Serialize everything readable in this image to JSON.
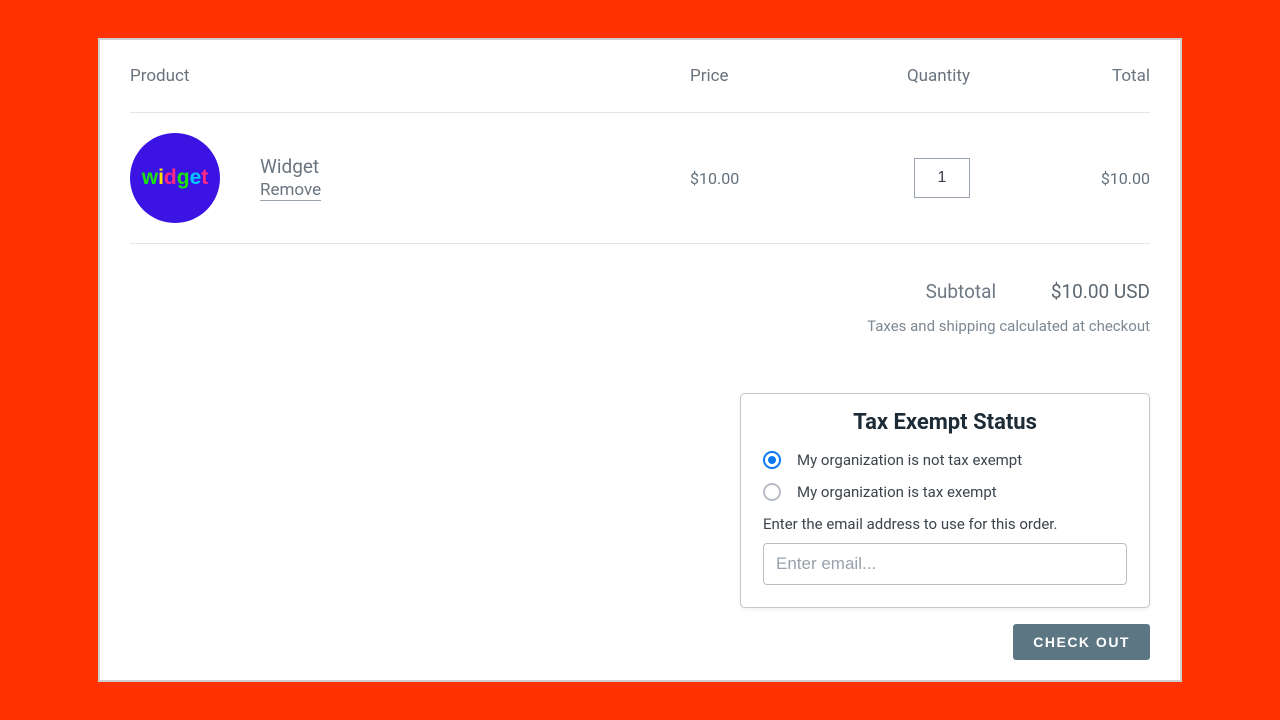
{
  "headers": {
    "product": "Product",
    "price": "Price",
    "quantity": "Quantity",
    "total": "Total"
  },
  "item": {
    "thumb_text": "widget",
    "name": "Widget",
    "remove": "Remove",
    "price": "$10.00",
    "quantity": "1",
    "total": "$10.00"
  },
  "summary": {
    "subtotal_label": "Subtotal",
    "subtotal_value": "$10.00 USD",
    "tax_note": "Taxes and shipping calculated at checkout"
  },
  "exempt": {
    "title": "Tax Exempt Status",
    "option_not_exempt": "My organization is not tax exempt",
    "option_exempt": "My organization is tax exempt",
    "email_label": "Enter the email address to use for this order.",
    "email_placeholder": "Enter email..."
  },
  "checkout_label": "CHECK OUT"
}
